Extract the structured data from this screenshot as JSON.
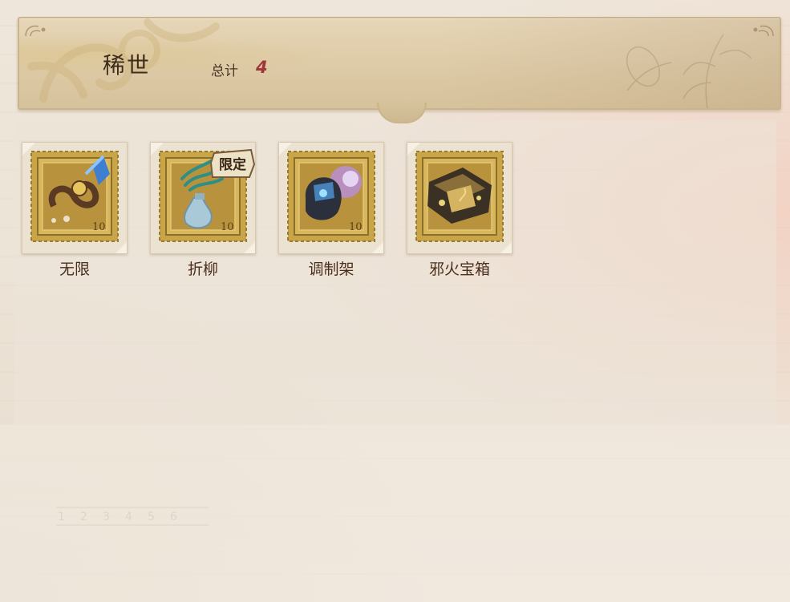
{
  "header": {
    "title": "稀世",
    "total_label": "总计",
    "total_value": "4"
  },
  "items": [
    {
      "label": "无限",
      "icon": "infinity-charm-icon",
      "limited": false
    },
    {
      "label": "折柳",
      "icon": "willow-vase-icon",
      "limited": true,
      "badge": "限定"
    },
    {
      "label": "调制架",
      "icon": "mixing-rack-icon",
      "limited": false
    },
    {
      "label": "邪火宝箱",
      "icon": "evil-fire-chest-icon",
      "limited": false
    }
  ],
  "stamp_value": "10",
  "colors": {
    "accent_red": "#a0353a",
    "stamp_gold": "#c9a54a",
    "text_brown": "#4a2f1c"
  }
}
